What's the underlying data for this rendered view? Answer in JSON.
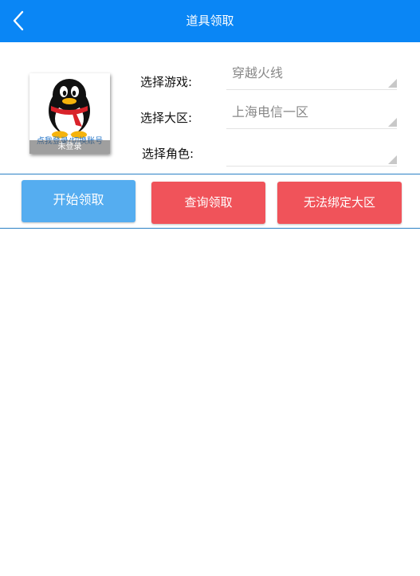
{
  "header": {
    "title": "道具领取",
    "back_icon": "chevron-left-icon",
    "background": "#0a86f5"
  },
  "profile": {
    "avatar_icon": "qq-penguin-icon",
    "login_link": "点我登录/切换账号",
    "status": "未登录"
  },
  "form": {
    "game": {
      "label": "选择游戏:",
      "value": "穿越火线"
    },
    "server": {
      "label": "选择大区:",
      "value": "上海电信一区"
    },
    "role": {
      "label": "选择角色:",
      "value": ""
    }
  },
  "actions": {
    "start_label": "开始领取",
    "query_label": "查询领取",
    "bind_label": "无法绑定大区",
    "start_color": "#55adf0",
    "danger_color": "#f0535a"
  }
}
